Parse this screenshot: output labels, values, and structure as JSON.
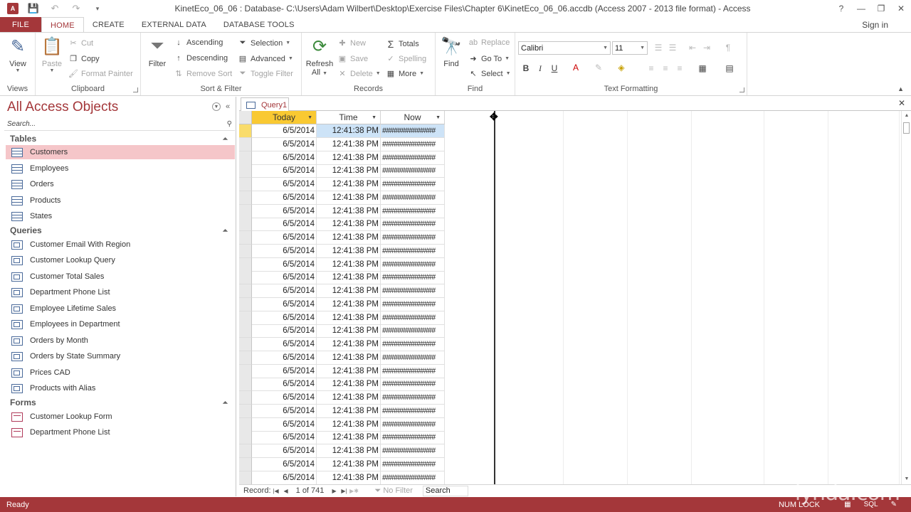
{
  "window": {
    "title": "KinetEco_06_06 : Database- C:\\Users\\Adam Wilbert\\Desktop\\Exercise Files\\Chapter 6\\KinetEco_06_06.accdb (Access 2007 - 2013 file format) - Access",
    "app_icon": "A",
    "help": "?",
    "minimize": "—",
    "restore": "❐",
    "close": "✕"
  },
  "tabs": {
    "file": "FILE",
    "home": "HOME",
    "create": "CREATE",
    "external": "EXTERNAL DATA",
    "dbtools": "DATABASE TOOLS",
    "signin": "Sign in"
  },
  "ribbon": {
    "views": {
      "view": "View",
      "label": "Views"
    },
    "clipboard": {
      "paste": "Paste",
      "cut": "Cut",
      "copy": "Copy",
      "format_painter": "Format Painter",
      "label": "Clipboard"
    },
    "sort_filter": {
      "filter": "Filter",
      "ascending": "Ascending",
      "descending": "Descending",
      "remove_sort": "Remove Sort",
      "selection": "Selection",
      "advanced": "Advanced",
      "toggle_filter": "Toggle Filter",
      "label": "Sort & Filter"
    },
    "records": {
      "refresh": "Refresh",
      "refresh_all": "All",
      "new": "New",
      "save": "Save",
      "delete": "Delete",
      "totals": "Totals",
      "spelling": "Spelling",
      "more": "More",
      "label": "Records"
    },
    "find": {
      "find": "Find",
      "replace": "Replace",
      "goto": "Go To",
      "select": "Select",
      "label": "Find"
    },
    "text_formatting": {
      "font": "Calibri",
      "size": "11",
      "bold": "B",
      "italic": "I",
      "underline": "U",
      "label": "Text Formatting"
    }
  },
  "nav": {
    "title": "All Access Objects",
    "search_placeholder": "Search...",
    "sections": {
      "tables": "Tables",
      "queries": "Queries",
      "forms": "Forms"
    },
    "tables": [
      "Customers",
      "Employees",
      "Orders",
      "Products",
      "States"
    ],
    "queries": [
      "Customer Email With Region",
      "Customer Lookup Query",
      "Customer Total Sales",
      "Department Phone List",
      "Employee Lifetime Sales",
      "Employees in Department",
      "Orders by Month",
      "Orders by State Summary",
      "Prices CAD",
      "Products with Alias"
    ],
    "forms": [
      "Customer Lookup Form",
      "Department Phone List"
    ]
  },
  "document": {
    "tab": "Query1",
    "columns": [
      "Today",
      "Time",
      "Now"
    ],
    "row": {
      "today": "6/5/2014",
      "time": "12:41:38 PM",
      "now": "##############"
    },
    "record_nav": {
      "label": "Record:",
      "position": "1 of 741",
      "no_filter": "No Filter",
      "search": "Search"
    }
  },
  "status": {
    "ready": "Ready",
    "numlock": "NUM LOCK",
    "sql": "SQL"
  },
  "watermark": "lynda.com"
}
